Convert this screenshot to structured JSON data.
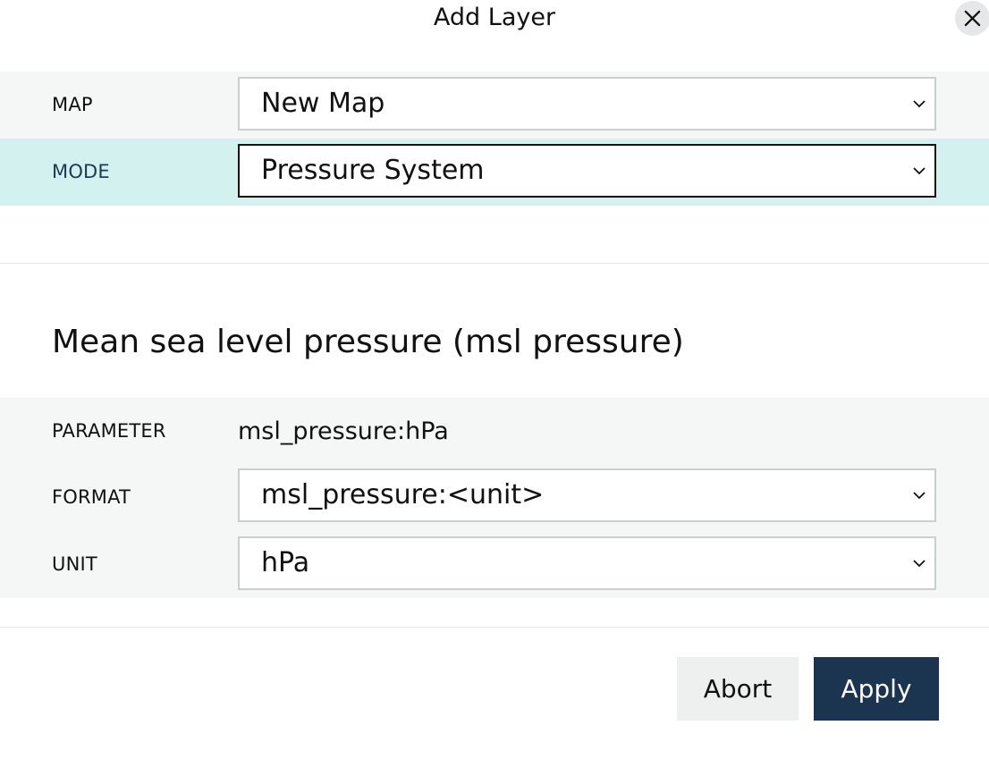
{
  "dialog": {
    "title": "Add Layer",
    "close_icon": "close-icon"
  },
  "map_row": {
    "label": "MAP",
    "value": "New Map"
  },
  "mode_row": {
    "label": "MODE",
    "value": "Pressure System"
  },
  "section": {
    "title": "Mean sea level pressure (msl pressure)"
  },
  "parameter": {
    "label": "PARAMETER",
    "value": "msl_pressure:hPa"
  },
  "format_row": {
    "label": "FORMAT",
    "value": "msl_pressure:<unit>"
  },
  "unit_row": {
    "label": "UNIT",
    "value": "hPa"
  },
  "actions": {
    "abort_label": "Abort",
    "apply_label": "Apply"
  },
  "colors": {
    "active_row_bg": "#d3f2ef",
    "panel_bg": "#f5f7f6",
    "apply_bg": "#1b3550",
    "abort_bg": "#eef0ef"
  }
}
